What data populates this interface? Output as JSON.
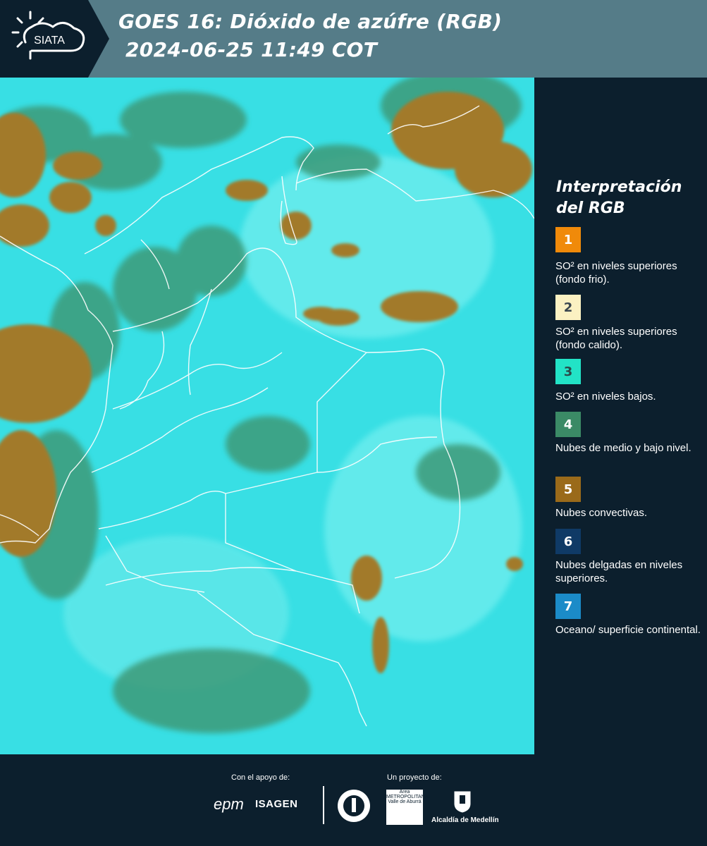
{
  "header": {
    "logo_text": "SIATA",
    "title_line1": "GOES 16: Dióxido de azúfre (RGB)",
    "title_line2": " 2024-06-25 11:49 COT"
  },
  "legend": {
    "title": "Interpretación del RGB",
    "items": [
      {
        "number": "1",
        "color": "#f08a0a",
        "text": "SO² en niveles superiores (fondo frio)."
      },
      {
        "number": "2",
        "color": "#fbf1c2",
        "text": "SO² en niveles superiores (fondo calido)."
      },
      {
        "number": "3",
        "color": "#22e3c6",
        "text": "SO² en niveles bajos."
      },
      {
        "number": "4",
        "color": "#3b8a66",
        "text": "Nubes de medio y bajo nivel."
      },
      {
        "number": "5",
        "color": "#9a6a1a",
        "text": "Nubes convectivas."
      },
      {
        "number": "6",
        "color": "#0f3a66",
        "text": "Nubes delgadas en niveles superiores."
      },
      {
        "number": "7",
        "color": "#1b8bc8",
        "text": "Oceano/ superficie continental."
      }
    ]
  },
  "map": {
    "background_color": "#35e0e4",
    "cloud_color": "#a27a2a",
    "midcloud_color": "#3e9a78",
    "border_color": "#ffffff"
  },
  "footer": {
    "support_label": "Con el apoyo de:",
    "project_label": "Un proyecto de:",
    "sponsor1": "epm",
    "sponsor2": "ISAGEN",
    "partner_metropolitana": "Área METROPOLITANA Valle de Aburrá",
    "partner_alcaldia": "Alcaldía de Medellín"
  }
}
